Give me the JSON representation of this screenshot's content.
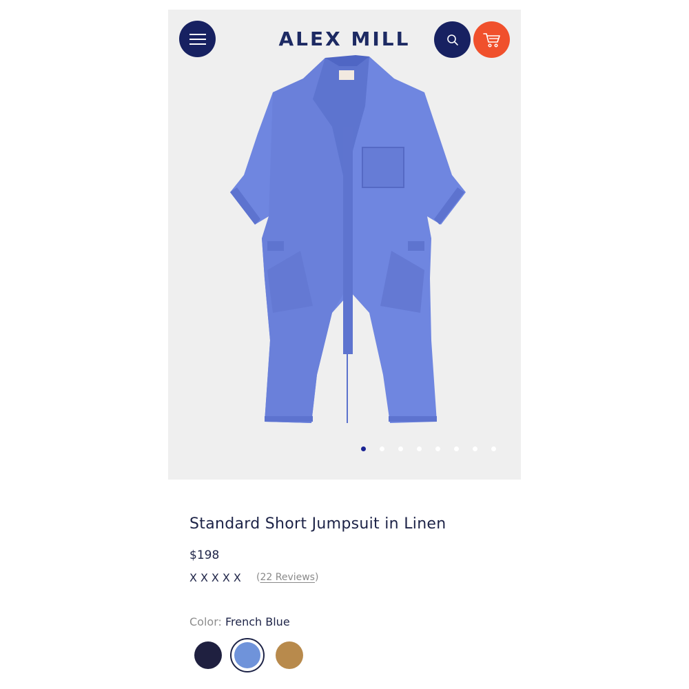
{
  "header": {
    "logo": "ALEX MILL",
    "menu_icon": "hamburger-menu-icon",
    "search_icon": "search-icon",
    "cart_icon": "shopping-cart-icon",
    "colors": {
      "navy": "#172161",
      "cart": "#f0502c"
    }
  },
  "carousel": {
    "slide_count": 8,
    "active_index": 0
  },
  "product": {
    "title": "Standard Short Jumpsuit in Linen",
    "price": "$198",
    "rating_glyphs": "XXXXX",
    "reviews_open": "(",
    "reviews_label": "22 Reviews",
    "reviews_close": ")",
    "color_label": "Color:",
    "color_value": "French Blue",
    "swatches": [
      {
        "name": "navy",
        "color": "#1f2040",
        "selected": false
      },
      {
        "name": "french-blue",
        "color": "#6f93da",
        "selected": true
      },
      {
        "name": "tan",
        "color": "#b88a4c",
        "selected": false
      }
    ]
  }
}
